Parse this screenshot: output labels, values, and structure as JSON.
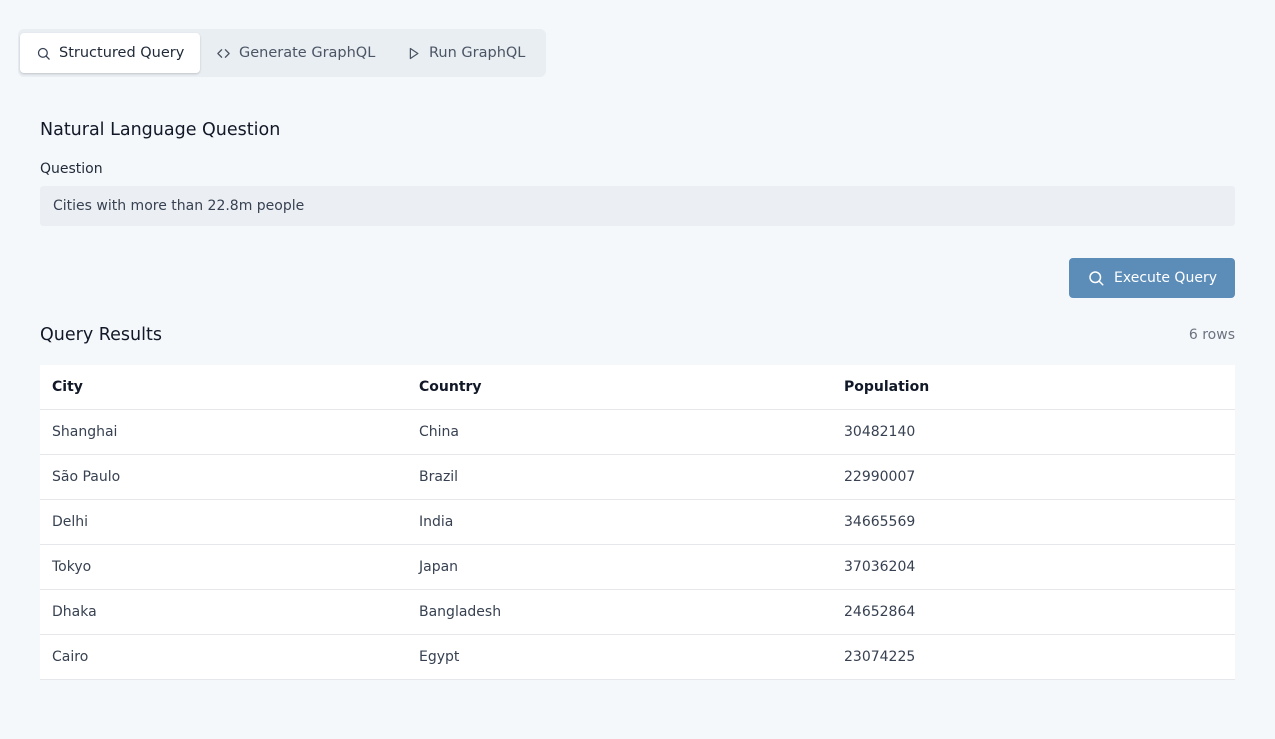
{
  "tabs": [
    {
      "label": "Structured Query",
      "icon": "search-icon",
      "active": true
    },
    {
      "label": "Generate GraphQL",
      "icon": "code-icon",
      "active": false
    },
    {
      "label": "Run GraphQL",
      "icon": "play-icon",
      "active": false
    }
  ],
  "question_section": {
    "title": "Natural Language Question",
    "field_label": "Question",
    "value": "Cities with more than 22.8m people",
    "placeholder": ""
  },
  "execute_button": {
    "label": "Execute Query",
    "icon": "search-icon",
    "color": "#5b8db8"
  },
  "results": {
    "title": "Query Results",
    "row_count": "6 rows",
    "columns": [
      "City",
      "Country",
      "Population"
    ],
    "rows": [
      [
        "Shanghai",
        "China",
        "30482140"
      ],
      [
        "São Paulo",
        "Brazil",
        "22990007"
      ],
      [
        "Delhi",
        "India",
        "34665569"
      ],
      [
        "Tokyo",
        "Japan",
        "37036204"
      ],
      [
        "Dhaka",
        "Bangladesh",
        "24652864"
      ],
      [
        "Cairo",
        "Egypt",
        "23074225"
      ]
    ]
  }
}
